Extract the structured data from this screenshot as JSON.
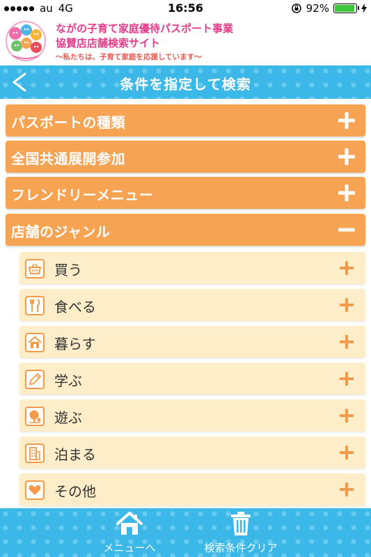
{
  "status_bar": {
    "carrier": "au",
    "network": "4G",
    "time": "16:56",
    "battery": "92%",
    "battery_level": 0.92
  },
  "header": {
    "title_line1": "ながの子育て家庭優待パスポート事業",
    "title_line2": "協賛店店舗検索サイト",
    "subtitle": "〜私たちは、子育て家庭を応援しています〜"
  },
  "nav": {
    "title": "条件を指定して検索",
    "back_icon": "chevron-left-icon"
  },
  "categories": [
    {
      "label": "パスポートの種類",
      "expanded": false
    },
    {
      "label": "全国共通展開参加",
      "expanded": false
    },
    {
      "label": "フレンドリーメニュー",
      "expanded": false
    },
    {
      "label": "店舗のジャンル",
      "expanded": true
    }
  ],
  "genres": [
    {
      "label": "買う",
      "icon": "basket-icon"
    },
    {
      "label": "食べる",
      "icon": "fork-knife-icon"
    },
    {
      "label": "暮らす",
      "icon": "house-icon"
    },
    {
      "label": "学ぶ",
      "icon": "pencil-icon"
    },
    {
      "label": "遊ぶ",
      "icon": "tree-icon"
    },
    {
      "label": "泊まる",
      "icon": "building-icon"
    },
    {
      "label": "その他",
      "icon": "heart-icon"
    }
  ],
  "bottom_bar": {
    "menu_label": "メニューへ",
    "clear_label": "検索条件クリア"
  },
  "colors": {
    "accent_blue": "#3bb8e8",
    "category_orange": "#f7a354",
    "genre_bg": "#fdedc8",
    "header_pink": "#e23c8a"
  }
}
